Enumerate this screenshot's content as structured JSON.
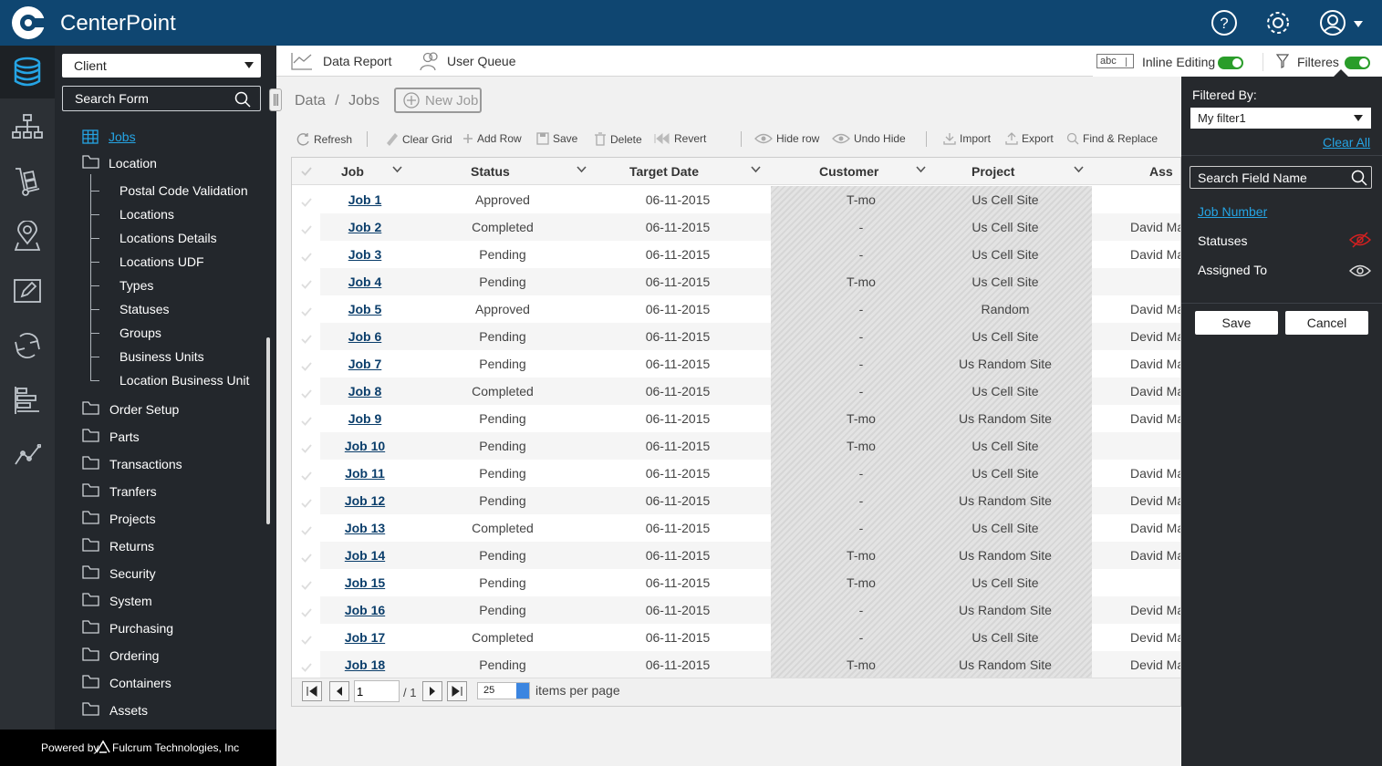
{
  "app": {
    "brand": "CenterPoint"
  },
  "topbar": {
    "icons": [
      "help-icon",
      "settings-icon",
      "user-icon",
      "chevron-down-icon"
    ]
  },
  "client_select": {
    "value": "Client"
  },
  "search_form": {
    "placeholder": "Search Form"
  },
  "tree": {
    "jobs": "Jobs",
    "location": "Location",
    "location_children": [
      "Postal Code Validation",
      "Locations",
      "Locations Details",
      "Locations UDF",
      "Types",
      "Statuses",
      "Groups",
      "Business Units",
      "Location Business Unit"
    ],
    "folders": [
      "Order Setup",
      "Parts",
      "Transactions",
      "Tranfers",
      "Projects",
      "Returns",
      "Security",
      "System",
      "Purchasing",
      "Ordering",
      "Containers",
      "Assets"
    ]
  },
  "footer": {
    "powered_by": "Powered by",
    "company": "Fulcrum Technologies, Inc"
  },
  "tabs": {
    "data_report": "Data Report",
    "user_queue": "User Queue",
    "abc": "abc",
    "inline_editing": "Inline Editing",
    "filteres": "Filteres"
  },
  "breadcrumb": {
    "data": "Data",
    "sep": "/",
    "jobs": "Jobs"
  },
  "new_job": "New Job",
  "toolbar": {
    "refresh": "Refresh",
    "clear_grid": "Clear Grid",
    "add_row": "Add Row",
    "save": "Save",
    "delete": "Delete",
    "revert": "Revert",
    "hide_row": "Hide row",
    "undo_hide": "Undo Hide",
    "import": "Import",
    "export": "Export",
    "find_replace": "Find & Replace"
  },
  "grid": {
    "columns": [
      "Job",
      "Status",
      "Target Date",
      "Customer",
      "Project",
      "Ass"
    ],
    "rows": [
      {
        "job": "Job 1",
        "status": "Approved",
        "date": "06-11-2015",
        "customer": "T-mo",
        "project": "Us Cell Site",
        "assigned": ""
      },
      {
        "job": "Job 2",
        "status": "Completed",
        "date": "06-11-2015",
        "customer": "-",
        "project": "Us Cell Site",
        "assigned": "David Ma"
      },
      {
        "job": "Job 3",
        "status": "Pending",
        "date": "06-11-2015",
        "customer": "-",
        "project": "Us Cell Site",
        "assigned": "David Ma"
      },
      {
        "job": "Job 4",
        "status": "Pending",
        "date": "06-11-2015",
        "customer": "T-mo",
        "project": "Us Cell Site",
        "assigned": ""
      },
      {
        "job": "Job 5",
        "status": "Approved",
        "date": "06-11-2015",
        "customer": "-",
        "project": "Random",
        "assigned": "David Ma"
      },
      {
        "job": "Job 6",
        "status": "Pending",
        "date": "06-11-2015",
        "customer": "-",
        "project": "Us Cell Site",
        "assigned": "Devid Ma"
      },
      {
        "job": "Job 7",
        "status": "Pending",
        "date": "06-11-2015",
        "customer": "-",
        "project": "Us Random Site",
        "assigned": "David Ma"
      },
      {
        "job": "Job 8",
        "status": "Completed",
        "date": "06-11-2015",
        "customer": "-",
        "project": "Us Cell Site",
        "assigned": "David Ma"
      },
      {
        "job": "Job 9",
        "status": "Pending",
        "date": "06-11-2015",
        "customer": "T-mo",
        "project": "Us Random Site",
        "assigned": "David Ma"
      },
      {
        "job": "Job 10",
        "status": "Pending",
        "date": "06-11-2015",
        "customer": "T-mo",
        "project": "Us Cell Site",
        "assigned": ""
      },
      {
        "job": "Job 11",
        "status": "Pending",
        "date": "06-11-2015",
        "customer": "-",
        "project": "Us Cell Site",
        "assigned": "David Ma"
      },
      {
        "job": "Job 12",
        "status": "Pending",
        "date": "06-11-2015",
        "customer": "-",
        "project": "Us Random Site",
        "assigned": "Devid Ma"
      },
      {
        "job": "Job 13",
        "status": "Completed",
        "date": "06-11-2015",
        "customer": "-",
        "project": "Us Cell Site",
        "assigned": "David Ma"
      },
      {
        "job": "Job 14",
        "status": "Pending",
        "date": "06-11-2015",
        "customer": "T-mo",
        "project": "Us Random Site",
        "assigned": "David Ma"
      },
      {
        "job": "Job 15",
        "status": "Pending",
        "date": "06-11-2015",
        "customer": "T-mo",
        "project": "Us Cell Site",
        "assigned": ""
      },
      {
        "job": "Job 16",
        "status": "Pending",
        "date": "06-11-2015",
        "customer": "-",
        "project": "Us Random Site",
        "assigned": "Devid Ma"
      },
      {
        "job": "Job 17",
        "status": "Completed",
        "date": "06-11-2015",
        "customer": "-",
        "project": "Us Cell Site",
        "assigned": "Devid Ma"
      },
      {
        "job": "Job 18",
        "status": "Pending",
        "date": "06-11-2015",
        "customer": "T-mo",
        "project": "Us Random Site",
        "assigned": "Devid Ma"
      }
    ]
  },
  "pager": {
    "page": "1",
    "of": "/ 1",
    "size": "25",
    "items_per_page": "items per page"
  },
  "filter_panel": {
    "filtered_by": "Filtered By:",
    "filter_value": "My filter1",
    "clear_all": "Clear All",
    "search_placeholder": "Search Field Name",
    "fields": [
      "Job Number",
      "Statuses",
      "Assigned To"
    ],
    "save": "Save",
    "cancel": "Cancel"
  },
  "colors": {
    "topbar": "#0f4671",
    "link": "#25a4e4",
    "toggle_on": "#2a9d2a",
    "hidden_icon": "#d62020"
  }
}
